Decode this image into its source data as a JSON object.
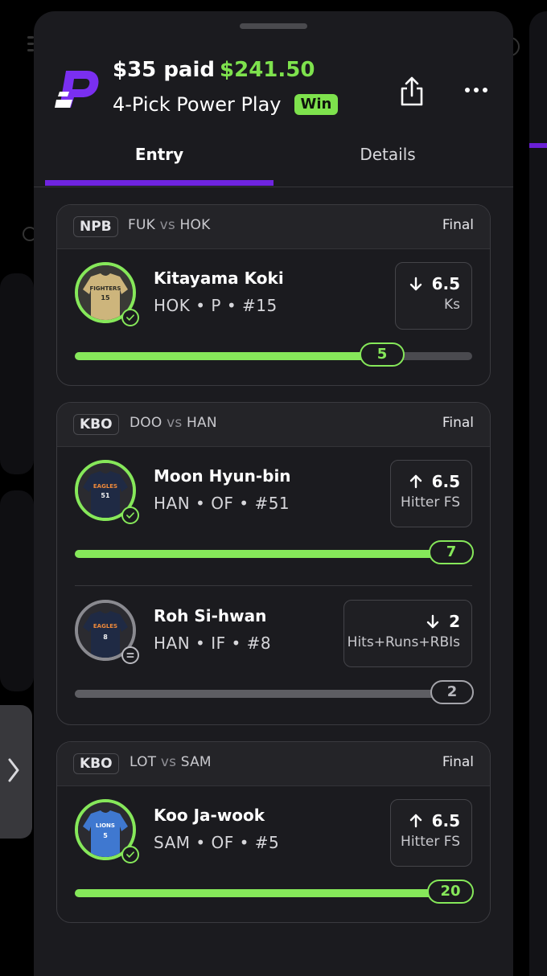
{
  "header": {
    "paid": "$35 paid",
    "winnings": "$241.50",
    "play_type": "4-Pick Power Play",
    "result_badge": "Win"
  },
  "tabs": [
    {
      "label": "Entry",
      "active": true
    },
    {
      "label": "Details",
      "active": false
    }
  ],
  "colors": {
    "accent_purple": "#6f24e0",
    "win_green": "#7ee24d",
    "sheet_bg": "#1b1b1f"
  },
  "cards": [
    {
      "league": "NPB",
      "team_a": "FUK",
      "vs": "vs",
      "team_b": "HOK",
      "status": "Final",
      "picks": [
        {
          "name": "Kitayama Koki",
          "meta": "HOK • P • #15",
          "jersey_text": "FIGHTERS",
          "jersey_number": "15",
          "direction": "down",
          "line": "6.5",
          "stat": "Ks",
          "actual": "5",
          "result": "hit",
          "progress": 0.77
        }
      ]
    },
    {
      "league": "KBO",
      "team_a": "DOO",
      "vs": "vs",
      "team_b": "HAN",
      "status": "Final",
      "picks": [
        {
          "name": "Moon Hyun-bin",
          "meta": "HAN • OF • #51",
          "jersey_text": "EAGLES",
          "jersey_number": "51",
          "direction": "up",
          "line": "6.5",
          "stat": "Hitter FS",
          "actual": "7",
          "result": "hit",
          "progress": 1.0
        },
        {
          "name": "Roh Si-hwan",
          "meta": "HAN • IF • #8",
          "jersey_text": "EAGLES",
          "jersey_number": "8",
          "direction": "down",
          "line": "2",
          "stat": "Hits+Runs+RBIs",
          "actual": "2",
          "result": "push",
          "progress": 1.0
        }
      ]
    },
    {
      "league": "KBO",
      "team_a": "LOT",
      "vs": "vs",
      "team_b": "SAM",
      "status": "Final",
      "picks": [
        {
          "name": "Koo Ja-wook",
          "meta": "SAM • OF • #5",
          "jersey_text": "LIONS",
          "jersey_number": "5",
          "direction": "up",
          "line": "6.5",
          "stat": "Hitter FS",
          "actual": "20",
          "result": "hit",
          "progress": 1.0
        }
      ]
    }
  ]
}
